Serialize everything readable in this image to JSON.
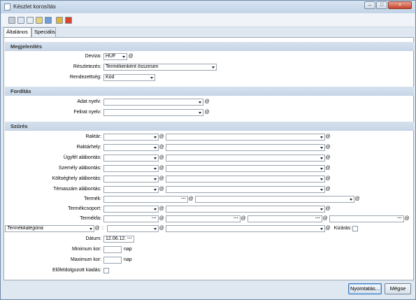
{
  "window": {
    "title": "Készlet korosítás",
    "buttons": [
      "–",
      "□",
      "×"
    ]
  },
  "tabs": [
    "Általános",
    "Speciális"
  ],
  "sections": {
    "display": "Megjelenítés",
    "translation": "Fordítás",
    "filter": "Szűrés"
  },
  "display": {
    "currency_label": "Deviza:",
    "currency_value": "HUF",
    "detail_label": "Részletezés:",
    "detail_value": "Termékenként összesen",
    "order_label": "Rendezettség:",
    "order_value": "Kód"
  },
  "translation": {
    "data_lang_label": "Adat nyelv:",
    "caption_lang_label": "Felirat nyelv:"
  },
  "filter": {
    "warehouse": "Raktár:",
    "location": "Raktárhely:",
    "customer_breakdown": "Ügyfél alábontás:",
    "person_breakdown": "Személy alábontás:",
    "costcenter_breakdown": "Költséghely alábontás:",
    "topic_breakdown": "Témaszám alábontás:",
    "product": "Termék:",
    "product_group": "Termékcsoport:",
    "product_tree": "Termékfa:",
    "product_category": "Termékkategória",
    "colon": ":",
    "exclude_label": "Kizárás:",
    "date_label": "Dátum:",
    "date_value": "12.06.12.",
    "min_age_label": "Minimum kor:",
    "max_age_label": "Maximum kor:",
    "age_unit": "nap",
    "preprocessed_label": "Előfeldolgozott kiadás:"
  },
  "footer": {
    "print": "Nyomtatás...",
    "cancel": "Mégse"
  },
  "icons": [
    "print-icon",
    "preview-icon",
    "copy-icon",
    "edit-icon",
    "save-icon",
    "filter-icon",
    "export-icon"
  ]
}
